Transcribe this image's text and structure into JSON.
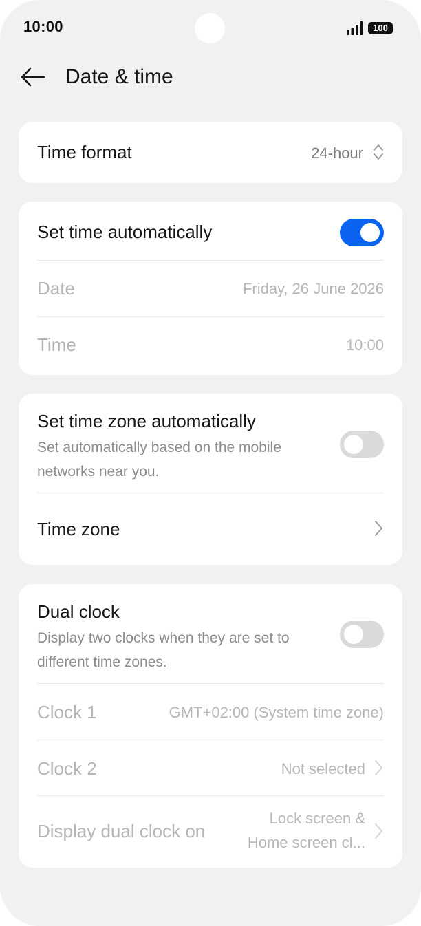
{
  "status_bar": {
    "time": "10:00",
    "battery": "100"
  },
  "header": {
    "title": "Date & time"
  },
  "time_format": {
    "label": "Time format",
    "value": "24-hour"
  },
  "auto_time": {
    "label": "Set time automatically",
    "enabled": true,
    "date_label": "Date",
    "date_value": "Friday, 26 June 2026",
    "time_label": "Time",
    "time_value": "10:00"
  },
  "time_zone": {
    "auto_label": "Set time zone automatically",
    "auto_desc": "Set automatically based on the mobile networks near you.",
    "auto_enabled": false,
    "zone_label": "Time zone"
  },
  "dual_clock": {
    "label": "Dual clock",
    "desc": "Display two clocks when they are set to different time zones.",
    "enabled": false,
    "clock1_label": "Clock 1",
    "clock1_value": "GMT+02:00 (System time zone)",
    "clock2_label": "Clock 2",
    "clock2_value": "Not selected",
    "display_label": "Display dual clock on",
    "display_value_line1": "Lock screen &",
    "display_value_line2": "Home screen cl..."
  },
  "colors": {
    "accent": "#0a63f0",
    "background": "#f0f1f3",
    "card": "#ffffff"
  },
  "icons": [
    "back-arrow-icon",
    "up-down-chevron-icon",
    "chevron-right-icon",
    "signal-icon",
    "battery-icon"
  ]
}
